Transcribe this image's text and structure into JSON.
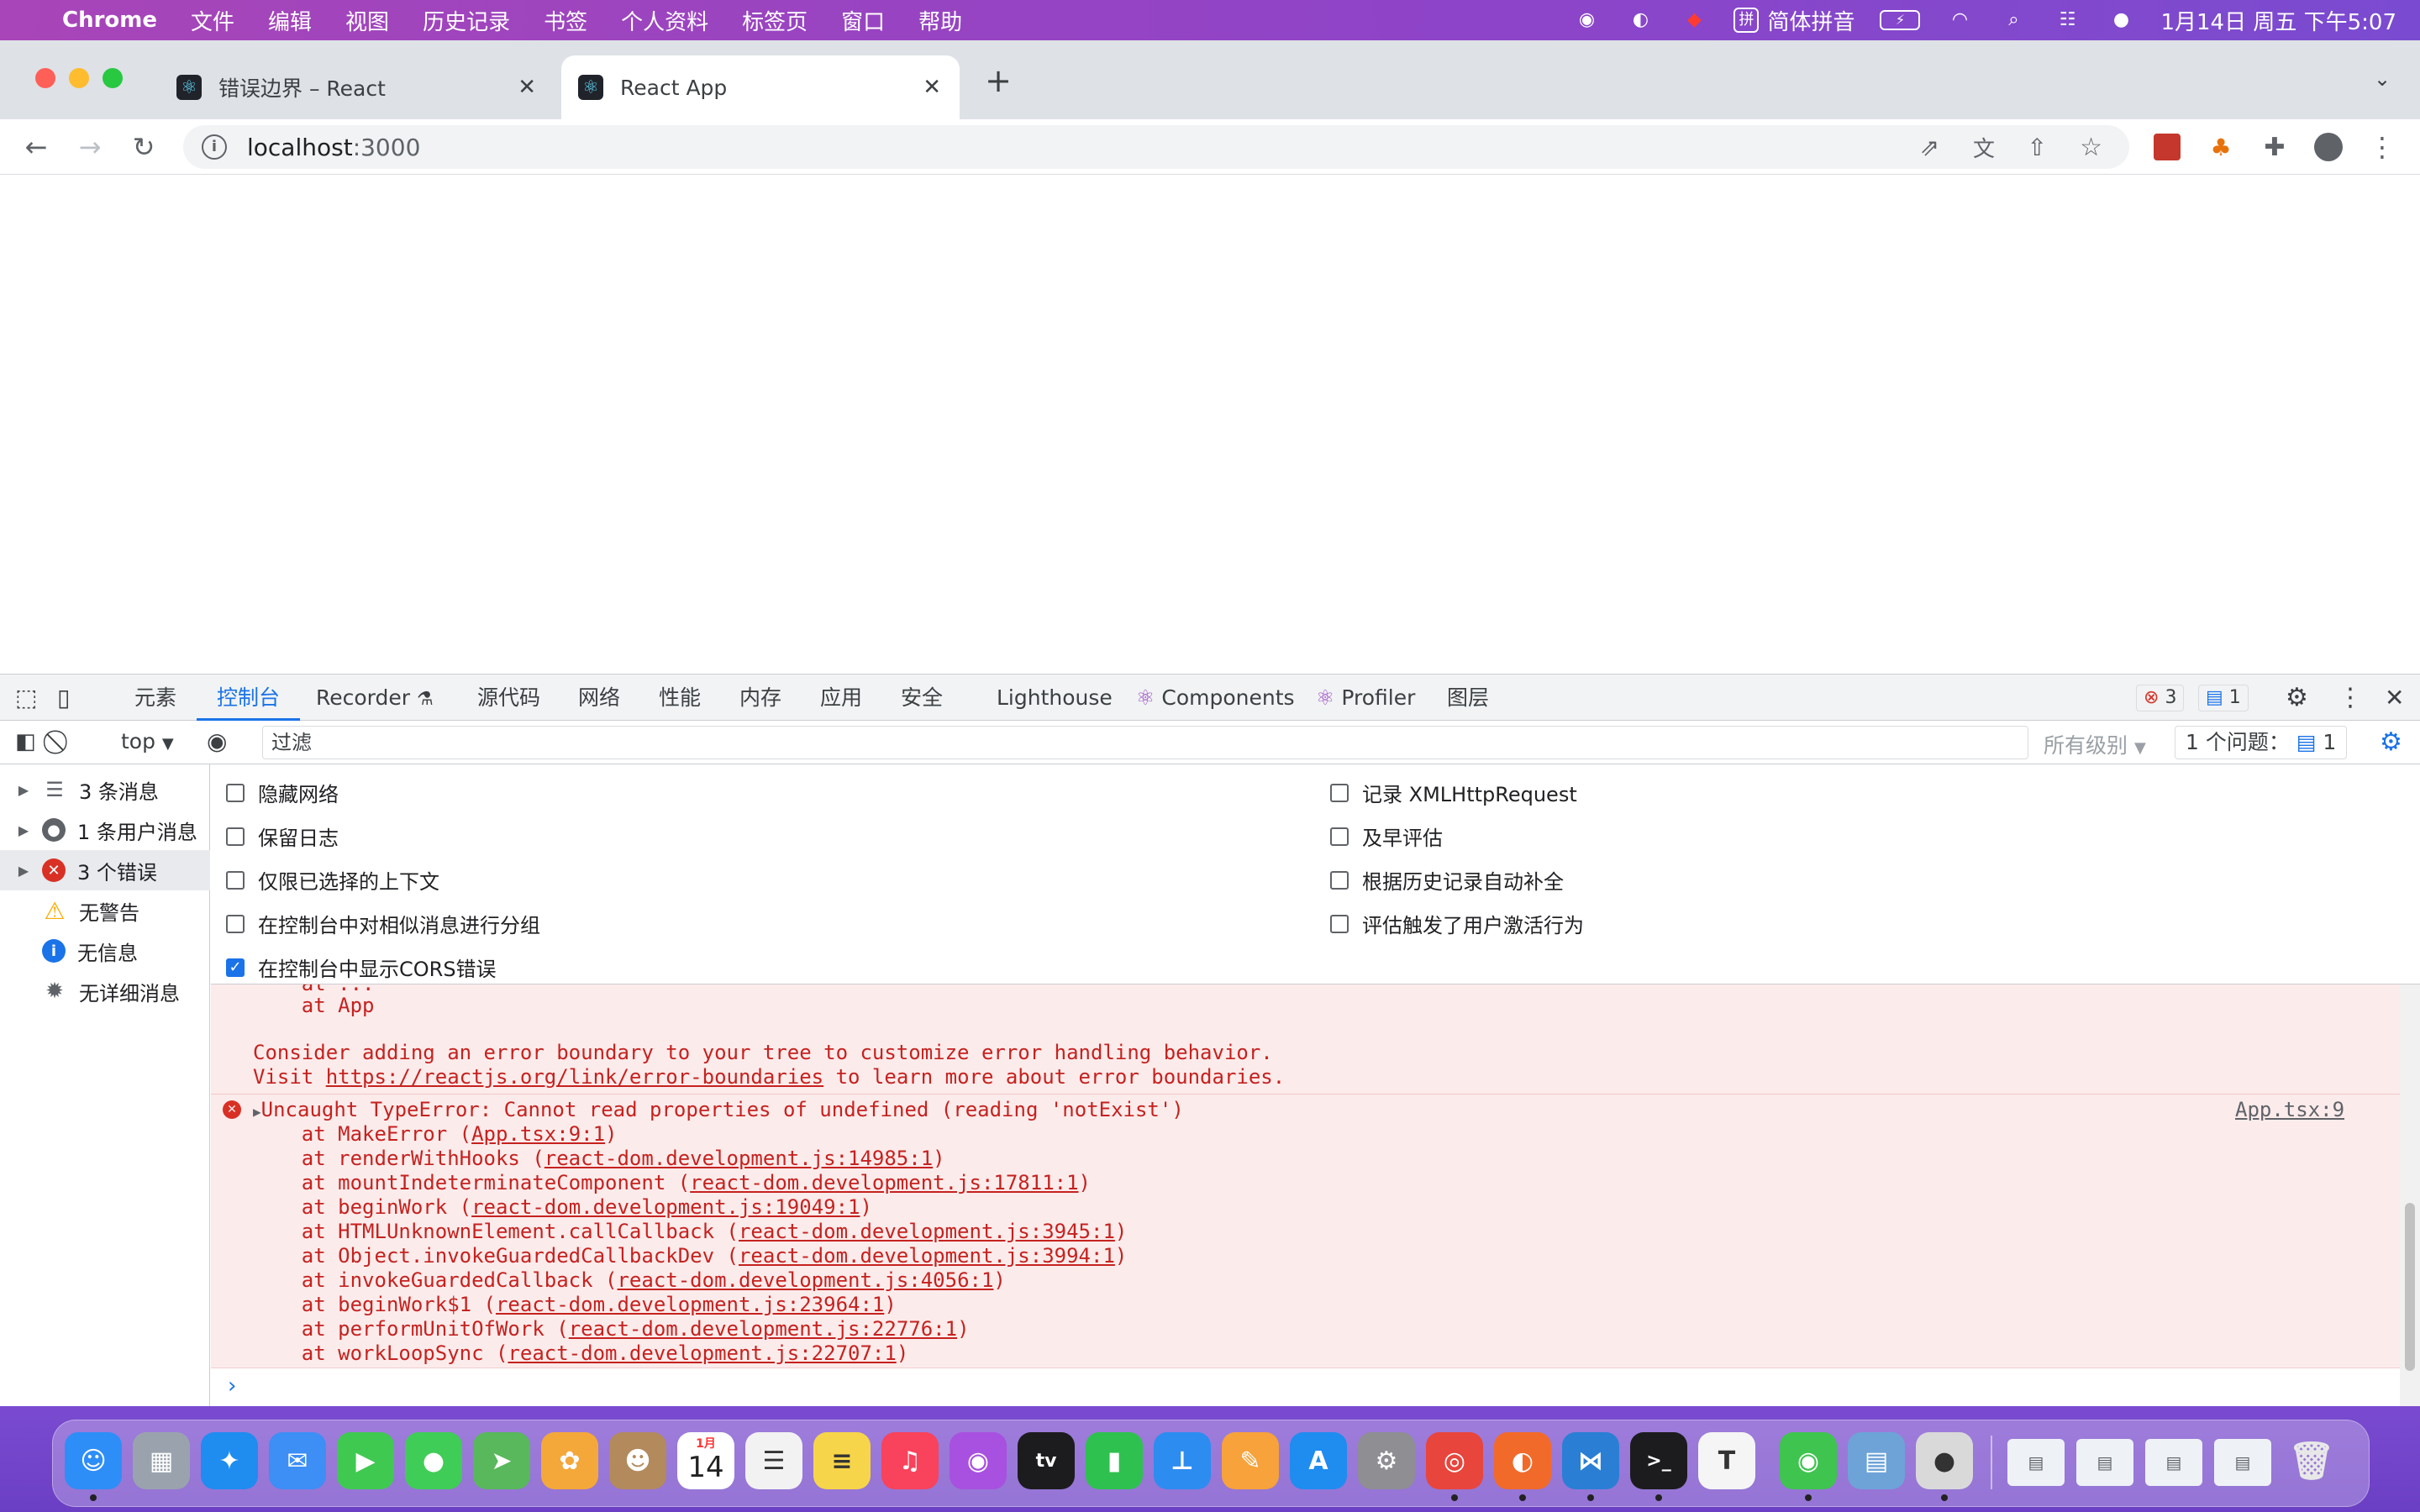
{
  "menubar": {
    "app": "Chrome",
    "items": [
      "文件",
      "编辑",
      "视图",
      "历史记录",
      "书签",
      "个人资料",
      "标签页",
      "窗口",
      "帮助"
    ],
    "input_method": "简体拼音",
    "clock": "1月14日 周五 下午5:07"
  },
  "tabs": [
    {
      "title": "错误边界 – React",
      "active": false
    },
    {
      "title": "React App",
      "active": true
    }
  ],
  "address": {
    "host": "localhost",
    "port": ":3000"
  },
  "devtools": {
    "tabs": [
      "元素",
      "控制台",
      "Recorder",
      "源代码",
      "网络",
      "性能",
      "内存",
      "应用",
      "安全",
      "Lighthouse",
      "Components",
      "Profiler",
      "图层"
    ],
    "selected_tab": "控制台",
    "error_count": "3",
    "message_count": "1"
  },
  "console_bar": {
    "context": "top",
    "filter_placeholder": "过滤",
    "levels": "所有级别",
    "issues_label": "1 个问题：",
    "issues_count": "1"
  },
  "sidebar": [
    {
      "label": "3 条消息",
      "icon": "list-icon",
      "expandable": true,
      "selected": false
    },
    {
      "label": "1 条用户消息",
      "icon": "user-icon",
      "expandable": true,
      "selected": false
    },
    {
      "label": "3 个错误",
      "icon": "error-icon",
      "expandable": true,
      "selected": true
    },
    {
      "label": "无警告",
      "icon": "warning-icon",
      "expandable": false,
      "selected": false
    },
    {
      "label": "无信息",
      "icon": "info-icon",
      "expandable": false,
      "selected": false
    },
    {
      "label": "无详细消息",
      "icon": "bug-icon",
      "expandable": false,
      "selected": false
    }
  ],
  "settings": {
    "left": [
      {
        "label": "隐藏网络",
        "checked": false
      },
      {
        "label": "保留日志",
        "checked": false
      },
      {
        "label": "仅限已选择的上下文",
        "checked": false
      },
      {
        "label": "在控制台中对相似消息进行分组",
        "checked": false
      },
      {
        "label": "在控制台中显示CORS错误",
        "checked": true
      }
    ],
    "right": [
      {
        "label": "记录 XMLHttpRequest",
        "checked": false
      },
      {
        "label": "及早评估",
        "checked": false
      },
      {
        "label": "根据历史记录自动补全",
        "checked": false
      },
      {
        "label": "评估触发了用户激活行为",
        "checked": false
      }
    ]
  },
  "log": {
    "prev_tail": [
      "    at App"
    ],
    "advice_1": "Consider adding an error boundary to your tree to customize error handling behavior.",
    "advice_2_pre": "Visit ",
    "advice_2_link": "https://reactjs.org/link/error-boundaries",
    "advice_2_post": " to learn more about error boundaries.",
    "error_message": "Uncaught TypeError: Cannot read properties of undefined (reading 'notExist')",
    "error_source": "App.tsx:9",
    "stack": [
      {
        "fn": "    at MakeError (",
        "src": "App.tsx:9:1",
        "end": ")"
      },
      {
        "fn": "    at renderWithHooks (",
        "src": "react-dom.development.js:14985:1",
        "end": ")"
      },
      {
        "fn": "    at mountIndeterminateComponent (",
        "src": "react-dom.development.js:17811:1",
        "end": ")"
      },
      {
        "fn": "    at beginWork (",
        "src": "react-dom.development.js:19049:1",
        "end": ")"
      },
      {
        "fn": "    at HTMLUnknownElement.callCallback (",
        "src": "react-dom.development.js:3945:1",
        "end": ")"
      },
      {
        "fn": "    at Object.invokeGuardedCallbackDev (",
        "src": "react-dom.development.js:3994:1",
        "end": ")"
      },
      {
        "fn": "    at invokeGuardedCallback (",
        "src": "react-dom.development.js:4056:1",
        "end": ")"
      },
      {
        "fn": "    at beginWork$1 (",
        "src": "react-dom.development.js:23964:1",
        "end": ")"
      },
      {
        "fn": "    at performUnitOfWork (",
        "src": "react-dom.development.js:22776:1",
        "end": ")"
      },
      {
        "fn": "    at workLoopSync (",
        "src": "react-dom.development.js:22707:1",
        "end": ")"
      }
    ]
  },
  "dock": {
    "calendar_month": "1月",
    "calendar_day": "14",
    "apps": [
      {
        "name": "finder",
        "color": "#2e8ef7",
        "glyph": "☺"
      },
      {
        "name": "launchpad",
        "color": "#9aa3ad",
        "glyph": "▦"
      },
      {
        "name": "safari",
        "color": "#1f8cf0",
        "glyph": "✦"
      },
      {
        "name": "mail",
        "color": "#3d8ef5",
        "glyph": "✉"
      },
      {
        "name": "facetime",
        "color": "#3fc951",
        "glyph": "▶"
      },
      {
        "name": "messages",
        "color": "#3fcd57",
        "glyph": "●"
      },
      {
        "name": "maps",
        "color": "#58b85b",
        "glyph": "➤"
      },
      {
        "name": "photos",
        "color": "#f4a83a",
        "glyph": "✿"
      },
      {
        "name": "contacts",
        "color": "#b28a5c",
        "glyph": "☻"
      },
      {
        "name": "calendar",
        "color": "#ffffff",
        "glyph": ""
      },
      {
        "name": "reminders",
        "color": "#f2f2f2",
        "glyph": "☰"
      },
      {
        "name": "notes",
        "color": "#f7d54a",
        "glyph": "≡"
      },
      {
        "name": "music",
        "color": "#f9425b",
        "glyph": "♫"
      },
      {
        "name": "podcasts",
        "color": "#a850e0",
        "glyph": "◉"
      },
      {
        "name": "tv",
        "color": "#1c1c1e",
        "glyph": "tv"
      },
      {
        "name": "numbers",
        "color": "#2ec14f",
        "glyph": "▮"
      },
      {
        "name": "keynote",
        "color": "#2d8cf0",
        "glyph": "⊥"
      },
      {
        "name": "pages",
        "color": "#f7a23a",
        "glyph": "✎"
      },
      {
        "name": "app-store",
        "color": "#1f8cf0",
        "glyph": "A"
      },
      {
        "name": "system-preferences",
        "color": "#8e8e93",
        "glyph": "⚙"
      },
      {
        "name": "chrome",
        "color": "#e8453c",
        "glyph": "◎"
      },
      {
        "name": "firefox",
        "color": "#f26a2a",
        "glyph": "◐"
      },
      {
        "name": "vscode",
        "color": "#2a7fd4",
        "glyph": "⋈"
      },
      {
        "name": "terminal",
        "color": "#1c1c1e",
        "glyph": ">_"
      },
      {
        "name": "typora",
        "color": "#f5f5f5",
        "glyph": "T"
      },
      {
        "name": "wechat",
        "color": "#3ec44f",
        "glyph": "◉"
      },
      {
        "name": "preview",
        "color": "#6ea3d8",
        "glyph": "▤"
      },
      {
        "name": "screen-recorder",
        "color": "#d9d9d9",
        "glyph": "●"
      }
    ]
  }
}
